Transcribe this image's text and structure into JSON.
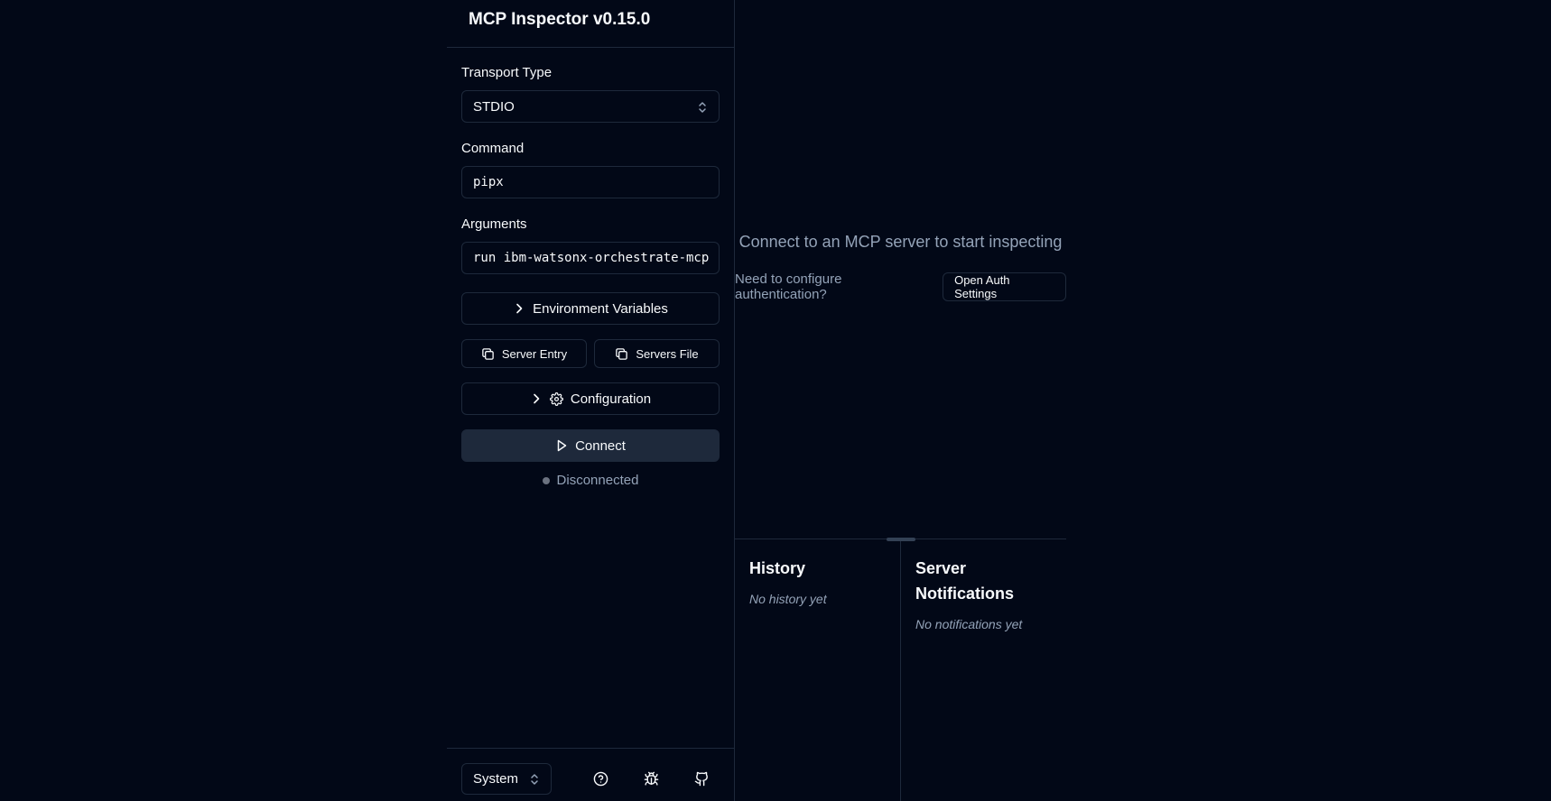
{
  "app": {
    "title": "MCP Inspector v0.15.0"
  },
  "sidebar": {
    "transport_label": "Transport Type",
    "transport_value": "STDIO",
    "command_label": "Command",
    "command_value": "pipx",
    "arguments_label": "Arguments",
    "arguments_value": "run ibm-watsonx-orchestrate-mcp",
    "env_vars_label": "Environment Variables",
    "server_entry_label": "Server Entry",
    "servers_file_label": "Servers File",
    "configuration_label": "Configuration",
    "connect_label": "Connect",
    "status_text": "Disconnected",
    "status_color": "#6b7280"
  },
  "footer": {
    "theme_value": "System",
    "icons": [
      "help-icon",
      "bug-icon",
      "github-icon"
    ]
  },
  "main": {
    "empty_title": "Connect to an MCP server to start inspecting",
    "auth_prompt": "Need to configure authentication?",
    "auth_button": "Open Auth Settings"
  },
  "history": {
    "title": "History",
    "empty": "No history yet"
  },
  "notifications": {
    "title": "Server Notifications",
    "empty": "No notifications yet"
  },
  "colors": {
    "background": "#020817",
    "border": "#1e293b",
    "muted_text": "#94a3b8",
    "connect_bg": "#1e293b"
  }
}
